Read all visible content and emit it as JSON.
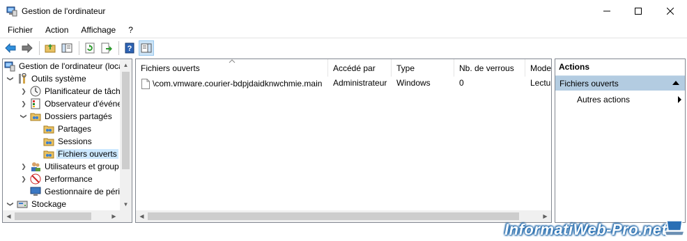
{
  "window": {
    "title": "Gestion de l'ordinateur",
    "controls": {
      "minimize": "—",
      "maximize": "☐",
      "close": "✕"
    }
  },
  "menu": [
    "Fichier",
    "Action",
    "Affichage",
    "?"
  ],
  "toolbar": {
    "buttons": [
      "back-arrow-icon",
      "forward-arrow-icon",
      "up-folder-icon",
      "show-hide-tree-icon",
      "refresh-icon",
      "export-list-icon",
      "help-icon",
      "show-hide-action-pane-icon"
    ]
  },
  "tree": {
    "items": [
      {
        "label": "Gestion de l'ordinateur (loca",
        "icon": "computer-management-icon",
        "expander": ""
      },
      {
        "label": "Outils système",
        "icon": "tools-icon",
        "expander": "open"
      },
      {
        "label": "Planificateur de tâch",
        "icon": "clock-icon",
        "expander": "closed"
      },
      {
        "label": "Observateur d'événe",
        "icon": "event-viewer-icon",
        "expander": "closed"
      },
      {
        "label": "Dossiers partagés",
        "icon": "shared-folder-icon",
        "expander": "open"
      },
      {
        "label": "Partages",
        "icon": "shared-folder-icon",
        "expander": ""
      },
      {
        "label": "Sessions",
        "icon": "shared-folder-icon",
        "expander": ""
      },
      {
        "label": "Fichiers ouverts",
        "icon": "shared-folder-icon",
        "expander": "",
        "selected": true
      },
      {
        "label": "Utilisateurs et group",
        "icon": "users-icon",
        "expander": "closed"
      },
      {
        "label": "Performance",
        "icon": "performance-icon",
        "expander": "closed"
      },
      {
        "label": "Gestionnaire de péri",
        "icon": "device-manager-icon",
        "expander": ""
      },
      {
        "label": "Stockage",
        "icon": "storage-icon",
        "expander": "open"
      }
    ]
  },
  "list": {
    "columns": [
      "Fichiers ouverts",
      "Accédé par",
      "Type",
      "Nb. de verrous",
      "Mode"
    ],
    "rows": [
      [
        "\\com.vmware.courier-bdpjdaidknwchmie.main",
        "Administrateur",
        "Windows",
        "0",
        "Lectu"
      ]
    ]
  },
  "actions": {
    "title": "Actions",
    "section": "Fichiers ouverts",
    "items": [
      "Autres actions"
    ]
  },
  "watermark": "InformatiWeb-Pro.net"
}
